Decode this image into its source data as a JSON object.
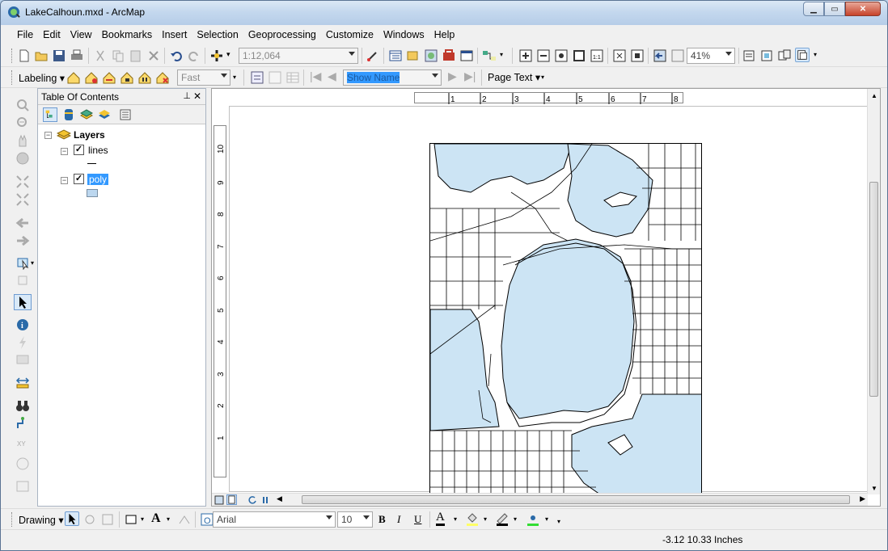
{
  "window": {
    "title": "LakeCalhoun.mxd - ArcMap"
  },
  "menu": [
    "File",
    "Edit",
    "View",
    "Bookmarks",
    "Insert",
    "Selection",
    "Geoprocessing",
    "Customize",
    "Windows",
    "Help"
  ],
  "standard_toolbar": {
    "scale": "1:12,064",
    "zoom_percent": "41%"
  },
  "labeling_toolbar": {
    "label": "Labeling",
    "quality": "Fast",
    "name_field": "Show Name",
    "page_text": "Page Text"
  },
  "toc": {
    "title": "Table Of Contents",
    "group": "Layers",
    "layers": [
      {
        "name": "lines",
        "checked": true,
        "selected": false
      },
      {
        "name": "poly",
        "checked": true,
        "selected": true
      }
    ]
  },
  "rulers": {
    "horizontal": [
      "1",
      "2",
      "3",
      "4",
      "5",
      "6",
      "7",
      "8"
    ],
    "vertical": [
      "10",
      "9",
      "8",
      "7",
      "6",
      "5",
      "4",
      "3",
      "2",
      "1"
    ]
  },
  "drawing_toolbar": {
    "label": "Drawing",
    "font": "Arial",
    "size": "10"
  },
  "status": {
    "coords": "-3.12  10.33 Inches"
  },
  "colors": {
    "water": "#cce4f4",
    "selection": "#3399ff"
  }
}
